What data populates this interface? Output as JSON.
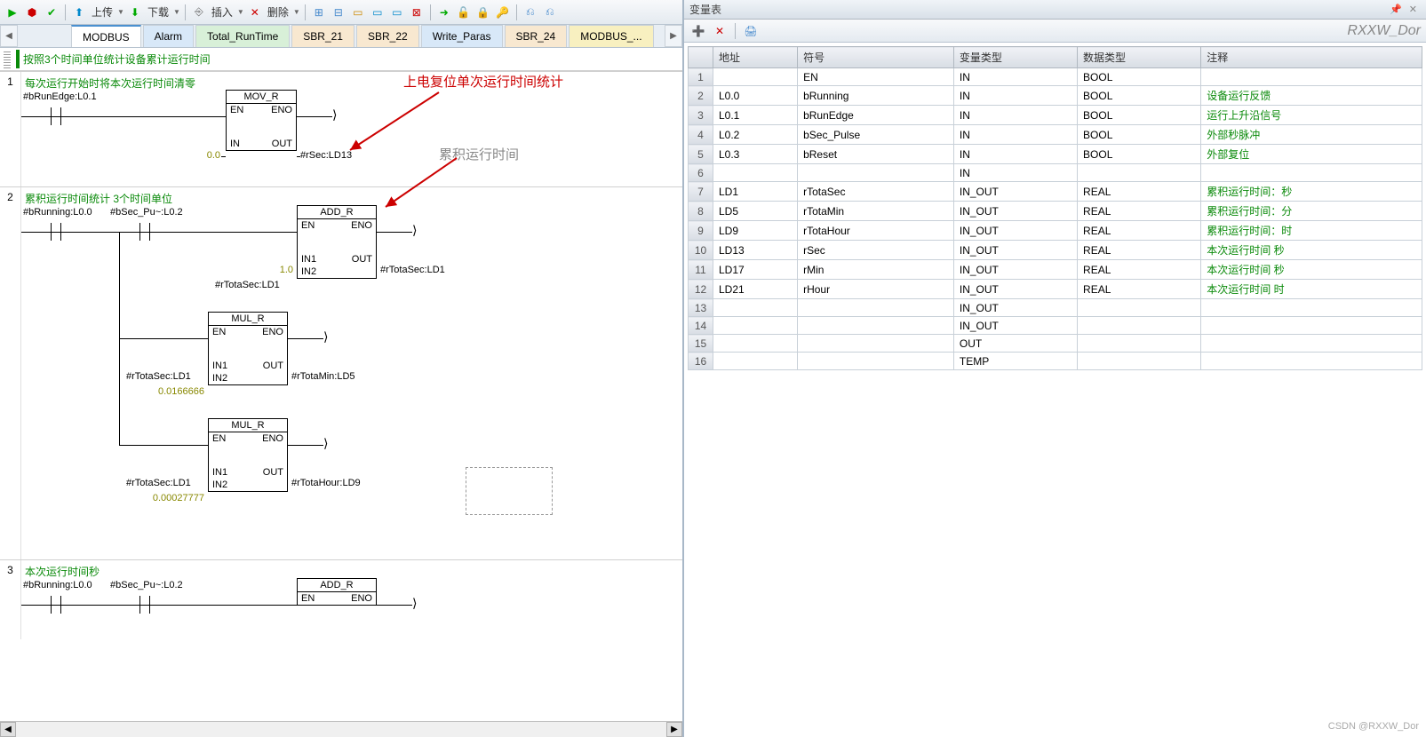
{
  "toolbar": {
    "upload": "上传",
    "download": "下载",
    "insert": "插入",
    "delete": "删除"
  },
  "tabs": [
    {
      "label": "MODBUS",
      "cls": "active"
    },
    {
      "label": "Alarm",
      "cls": "blue"
    },
    {
      "label": "Total_RunTime",
      "cls": "green"
    },
    {
      "label": "SBR_21",
      "cls": "orange"
    },
    {
      "label": "SBR_22",
      "cls": "orange"
    },
    {
      "label": "Write_Paras",
      "cls": "blue"
    },
    {
      "label": "SBR_24",
      "cls": "orange"
    },
    {
      "label": "MODBUS_...",
      "cls": "yellow"
    }
  ],
  "ladder": {
    "title": "按照3个时间单位统计设备累计运行时间",
    "net1": {
      "title": "每次运行开始时将本次运行时间清零",
      "contact": "#bRunEdge:L0.1",
      "block": "MOV_R",
      "en": "EN",
      "eno": "ENO",
      "in": "IN",
      "out": "OUT",
      "in_val": "0.0",
      "out_val": "#rSec:LD13"
    },
    "net2": {
      "title": "累积运行时间统计 3个时间单位",
      "c1": "#bRunning:L0.0",
      "c2": "#bSec_Pu~:L0.2",
      "b1": {
        "name": "ADD_R",
        "en": "EN",
        "eno": "ENO",
        "in1": "IN1",
        "in2": "IN2",
        "out": "OUT",
        "in1_val": "1.0",
        "in2_val": "#rTotaSec:LD1",
        "out_val": "#rTotaSec:LD1"
      },
      "b2": {
        "name": "MUL_R",
        "en": "EN",
        "eno": "ENO",
        "in1": "IN1",
        "in2": "IN2",
        "out": "OUT",
        "in1_val": "#rTotaSec:LD1",
        "in2_val": "0.0166666",
        "out_val": "#rTotaMin:LD5"
      },
      "b3": {
        "name": "MUL_R",
        "en": "EN",
        "eno": "ENO",
        "in1": "IN1",
        "in2": "IN2",
        "out": "OUT",
        "in1_val": "#rTotaSec:LD1",
        "in2_val": "0.00027777",
        "out_val": "#rTotaHour:LD9"
      }
    },
    "net3": {
      "title": "本次运行时间秒",
      "c1": "#bRunning:L0.0",
      "c2": "#bSec_Pu~:L0.2",
      "b1": {
        "name": "ADD_R",
        "en": "EN",
        "eno": "ENO"
      }
    },
    "anno1": "上电复位单次运行时间统计",
    "anno2": "累积运行时间"
  },
  "vartable": {
    "title": "变量表",
    "brand": "RXXW_Dor",
    "headers": [
      "地址",
      "符号",
      "变量类型",
      "数据类型",
      "注释"
    ],
    "rows": [
      {
        "n": "1",
        "addr": "",
        "sym": "EN",
        "vt": "IN",
        "dt": "BOOL",
        "c": ""
      },
      {
        "n": "2",
        "addr": "L0.0",
        "sym": "bRunning",
        "vt": "IN",
        "dt": "BOOL",
        "c": "设备运行反馈"
      },
      {
        "n": "3",
        "addr": "L0.1",
        "sym": "bRunEdge",
        "vt": "IN",
        "dt": "BOOL",
        "c": "运行上升沿信号"
      },
      {
        "n": "4",
        "addr": "L0.2",
        "sym": "bSec_Pulse",
        "vt": "IN",
        "dt": "BOOL",
        "c": "外部秒脉冲"
      },
      {
        "n": "5",
        "addr": "L0.3",
        "sym": "bReset",
        "vt": "IN",
        "dt": "BOOL",
        "c": "外部复位"
      },
      {
        "n": "6",
        "addr": "",
        "sym": "",
        "vt": "IN",
        "dt": "",
        "c": ""
      },
      {
        "n": "7",
        "addr": "LD1",
        "sym": "rTotaSec",
        "vt": "IN_OUT",
        "dt": "REAL",
        "c": "累积运行时间：秒"
      },
      {
        "n": "8",
        "addr": "LD5",
        "sym": "rTotaMin",
        "vt": "IN_OUT",
        "dt": "REAL",
        "c": "累积运行时间：分"
      },
      {
        "n": "9",
        "addr": "LD9",
        "sym": "rTotaHour",
        "vt": "IN_OUT",
        "dt": "REAL",
        "c": "累积运行时间：时"
      },
      {
        "n": "10",
        "addr": "LD13",
        "sym": "rSec",
        "vt": "IN_OUT",
        "dt": "REAL",
        "c": "本次运行时间 秒"
      },
      {
        "n": "11",
        "addr": "LD17",
        "sym": "rMin",
        "vt": "IN_OUT",
        "dt": "REAL",
        "c": "本次运行时间 秒"
      },
      {
        "n": "12",
        "addr": "LD21",
        "sym": "rHour",
        "vt": "IN_OUT",
        "dt": "REAL",
        "c": "本次运行时间 时"
      },
      {
        "n": "13",
        "addr": "",
        "sym": "",
        "vt": "IN_OUT",
        "dt": "",
        "c": ""
      },
      {
        "n": "14",
        "addr": "",
        "sym": "",
        "vt": "IN_OUT",
        "dt": "",
        "c": ""
      },
      {
        "n": "15",
        "addr": "",
        "sym": "",
        "vt": "OUT",
        "dt": "",
        "c": ""
      },
      {
        "n": "16",
        "addr": "",
        "sym": "",
        "vt": "TEMP",
        "dt": "",
        "c": ""
      }
    ]
  },
  "watermark": "CSDN @RXXW_Dor"
}
